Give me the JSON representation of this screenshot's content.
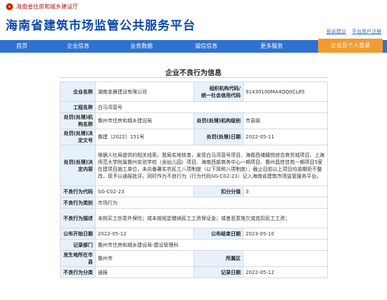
{
  "header": {
    "dept_name": "海南省住房和城乡建设厅",
    "site_title": "海南省建筑市场监管公共服务平台",
    "links": [
      "投诉建议",
      "平台用户注册"
    ]
  },
  "nav": {
    "items": [
      "首页",
      "企业信息",
      "业务数据",
      "诚信信息",
      "更多服务"
    ],
    "special": "企业及个人登录"
  },
  "panel": {
    "title": "企业不良行为信息"
  },
  "detail": {
    "company_label": "企业名称",
    "company_value": "湖南金晨建设有限公司",
    "org_code_label1": "组织机构代码/",
    "org_code_label2": "统一社会信用代码",
    "org_code_value": "91430100MA4QQ0CL85",
    "project_label": "工程名称",
    "project_value": "白马湾营号",
    "handling_org_label": "处罚(处理)机构名称",
    "handling_org_value": "儋州市住房和城乡建设局",
    "handling_level_label": "处罚(处理)机构级别",
    "handling_level_value": "市县级",
    "decision_no_label": "处罚(处理)决定文号",
    "decision_no_value": "儋建〔2022〕151号",
    "decision_date_label": "处罚(处理)日期",
    "decision_date_value": "2022-05-11",
    "decision_content_label": "处罚(处理)决定内容",
    "decision_content_value": "根据人社局提供的相关线索，我局实地核查，发现白马湾营号项目、海磊西埔檀悦综合商贸城项目、上海师范大学附属儋州实验学校（含幼儿园）项目、海南西部商务中心一期项目、儋州昌桂佳苑一期项目5家在建项目施工单位，未向番薯实农民工八项制度（以下简称八项制度）；截止目前以上项目均逾期拒不整改，现予以通报批评，同时作为不良行为（行为代码SG-C02-23）记入海南省建筑市场监管服务平台。",
    "behavior_code_label": "不良行为代码",
    "behavior_code_value": "SG-C02-23",
    "deduct_label": "扣分分值",
    "deduct_value": "3",
    "category_label": "不良行为类别",
    "category_value": "市场行为",
    "description_label": "不良行为描述",
    "description_value": "未购买工伤意外保险；或未按规定缴纳民工工资保证金；或者恶意拖欠或克扣民工工资；",
    "publish_date_label": "公布开始日期",
    "publish_date_value": "2022-05-12",
    "publish_end_label": "公布结束日期",
    "publish_end_value": "2023-05-10",
    "record_label": "记录部门",
    "record_value": "儋州市住房和城乡建设局-建设管理科",
    "location_label": "发生地所在市县",
    "location_value": "儋州市",
    "district_label": "所属区",
    "district_value": "",
    "classification_label": "不良行为分类",
    "classification_value": "通报",
    "entry_date_label": "记录日期",
    "entry_date_value": "2022-05-12"
  }
}
